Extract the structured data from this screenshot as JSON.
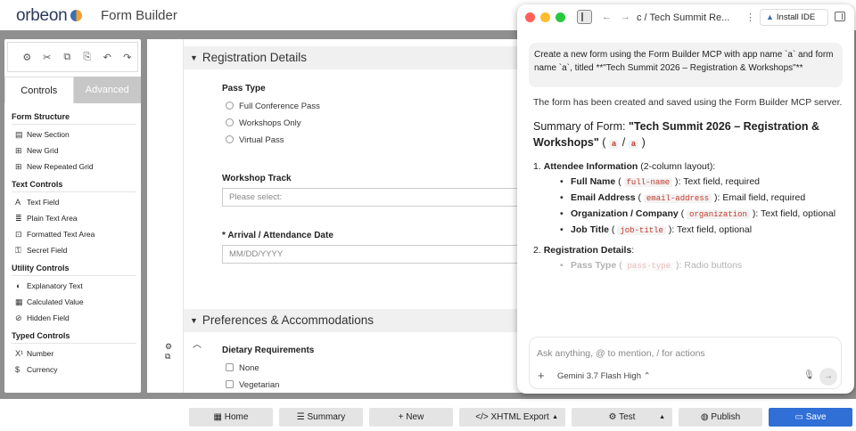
{
  "app": {
    "logo_text": "orbeon",
    "title": "Form Builder"
  },
  "toolbox": {
    "tool_icons": [
      "⚙",
      "✂",
      "⧉",
      "⎘",
      "↶",
      "↷"
    ],
    "tabs": {
      "controls": "Controls",
      "advanced": "Advanced"
    },
    "categories": [
      {
        "title": "Form Structure",
        "items": [
          {
            "label": "New Section",
            "icon": "▤"
          },
          {
            "label": "New Grid",
            "icon": "⊞"
          },
          {
            "label": "New Repeated Grid",
            "icon": "⊞"
          }
        ]
      },
      {
        "title": "Text Controls",
        "items": [
          {
            "label": "Text Field",
            "icon": "A"
          },
          {
            "label": "Plain Text Area",
            "icon": "≣"
          },
          {
            "label": "Formatted Text Area",
            "icon": "⊡"
          },
          {
            "label": "Secret Field",
            "icon": "⚿"
          }
        ]
      },
      {
        "title": "Utility Controls",
        "items": [
          {
            "label": "Explanatory Text",
            "icon": "◖"
          },
          {
            "label": "Calculated Value",
            "icon": "▦"
          },
          {
            "label": "Hidden Field",
            "icon": "⊘"
          }
        ]
      },
      {
        "title": "Typed Controls",
        "items": [
          {
            "label": "Number",
            "icon": "X¹"
          },
          {
            "label": "Currency",
            "icon": "$"
          }
        ]
      }
    ]
  },
  "form": {
    "section1": {
      "title": "Registration Details"
    },
    "pass_type": {
      "label": "Pass Type",
      "options": [
        "Full Conference Pass",
        "Workshops Only",
        "Virtual Pass"
      ]
    },
    "workshop_track": {
      "label": "Workshop Track",
      "placeholder": "Please select:"
    },
    "arrival": {
      "required_mark": "*",
      "label": "Arrival / Attendance Date",
      "placeholder": "MM/DD/YYYY"
    },
    "section2": {
      "title": "Preferences & Accommodations"
    },
    "dietary": {
      "label": "Dietary Requirements",
      "options": [
        "None",
        "Vegetarian"
      ]
    }
  },
  "bottom": {
    "home": "Home",
    "summary": "Summary",
    "new": "New",
    "xhtml_export": "XHTML Export",
    "test": "Test",
    "publish": "Publish",
    "save": "Save"
  },
  "ai": {
    "breadcrumb": "c  /  Tech Summit Re...",
    "install_ide": "Install IDE",
    "user_message": "Create a new form using the Form Builder MCP with app name `a` and form name `a`, titled **\"Tech Summit 2026 – Registration & Workshops\"**",
    "reply_intro": "The form has been created and saved using the Form Builder MCP server.",
    "summary_prefix": "Summary of Form: ",
    "summary_title": "\"Tech Summit 2026 – Registration & Workshops\"",
    "summary_app": "a",
    "summary_form": "a",
    "sec1_num": "1.",
    "sec1_title": "Attendee Information",
    "sec1_note": " (2-column layout):",
    "fields": [
      {
        "name": "Full Name",
        "code": "full-name",
        "desc": ": Text field, required"
      },
      {
        "name": "Email Address",
        "code": "email-address",
        "desc": ": Email field, required"
      },
      {
        "name": "Organization / Company",
        "code": "organization",
        "desc": ": Text field, optional"
      },
      {
        "name": "Job Title",
        "code": "job-title",
        "desc": ": Text field, optional"
      }
    ],
    "sec2_num": "2.",
    "sec2_title": "Registration Details",
    "sec2_note": ":",
    "pass_type_name": "Pass Type",
    "pass_type_code": "pass-type",
    "pass_type_desc": ": Radio buttons",
    "input_placeholder": "Ask anything, @ to mention, / for actions",
    "model": "Gemini 3.7 Flash High  ⌃"
  }
}
